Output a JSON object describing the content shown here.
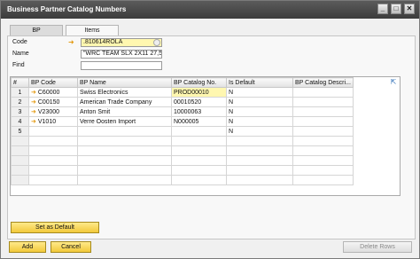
{
  "window": {
    "title": "Business Partner Catalog Numbers"
  },
  "window_buttons": [
    "_",
    "□",
    "✕"
  ],
  "tabs": [
    {
      "label": "BP"
    },
    {
      "label": "Items"
    }
  ],
  "form": {
    "code_label": "Code",
    "code_value": ".810614ROLA",
    "name_label": "Name",
    "name_value": "\"WRC TEAM SLX 2X11 27,5\"",
    "find_label": "Find",
    "find_value": ""
  },
  "grid": {
    "headers": [
      "#",
      "BP Code",
      "BP Name",
      "BP Catalog No.",
      "Is Default",
      "BP Catalog Descri..."
    ],
    "rows": [
      {
        "num": "1",
        "code": "C60000",
        "name": "Swiss Electronics",
        "catalog": "PROD00010",
        "default": "N",
        "desc": ""
      },
      {
        "num": "2",
        "code": "C00150",
        "name": "American Trade Company",
        "catalog": "00010520",
        "default": "N",
        "desc": ""
      },
      {
        "num": "3",
        "code": "V23000",
        "name": "Anton Smit",
        "catalog": "10000063",
        "default": "N",
        "desc": ""
      },
      {
        "num": "4",
        "code": "V1010",
        "name": "Verre Oosten Import",
        "catalog": "N000005",
        "default": "N",
        "desc": ""
      },
      {
        "num": "5",
        "code": "",
        "name": "",
        "catalog": "",
        "default": "N",
        "desc": ""
      }
    ]
  },
  "buttons": {
    "set_default": "Set as Default",
    "add": "Add",
    "cancel": "Cancel",
    "delete_rows": "Delete Rows"
  },
  "colors": {
    "accent": "#f2c93a",
    "titlebar": "#4a4a4a",
    "highlight": "#fff7b0"
  }
}
